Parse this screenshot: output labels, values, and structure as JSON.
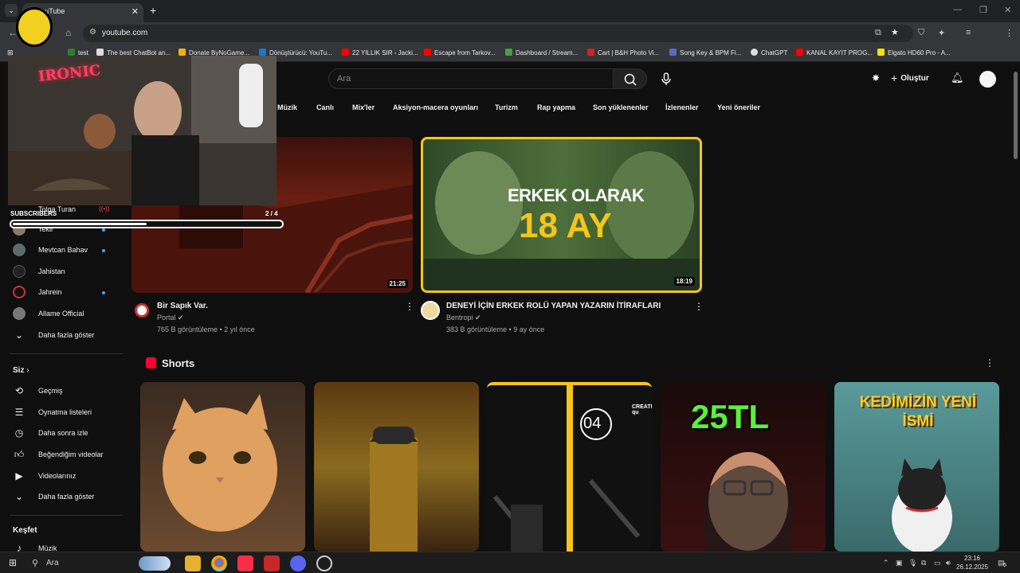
{
  "browser": {
    "tab_title": "YouTube",
    "url": "youtube.com",
    "bookmarks": [
      {
        "label": "test",
        "color": "#2e7d32"
      },
      {
        "label": "The best ChatBot an...",
        "color": "#dddddd"
      },
      {
        "label": "Donate ByNoGame...",
        "color": "#f5b400"
      },
      {
        "label": "Dönüştürücü: YouTu...",
        "color": "#e53935"
      },
      {
        "label": "22 YILLIK SIR - Jacki...",
        "color": "#ff0000"
      },
      {
        "label": "Escape from Tarkov...",
        "color": "#ff0000"
      },
      {
        "label": "Dashboard / Stream...",
        "color": "#43a047"
      },
      {
        "label": "Cart | B&H Photo Vi...",
        "color": "#c62828"
      },
      {
        "label": "Song Key & BPM Fi...",
        "color": "#5c6bc0"
      },
      {
        "label": "ChatGPT",
        "color": "#e0e0e0"
      },
      {
        "label": "KANAL KAYIT PROG...",
        "color": "#ff0000"
      },
      {
        "label": "Elgato HD60 Pro - A...",
        "color": "#f9e300"
      }
    ]
  },
  "youtube": {
    "search_placeholder": "Ara",
    "create_label": "Oluştur",
    "chips": [
      "Müzik",
      "Canlı",
      "Mix'ler",
      "Aksiyon-macera oyunları",
      "Turizm",
      "Rap yapma",
      "Son yüklenenler",
      "İzlenenler",
      "Yeni öneriler"
    ],
    "subscriptions": [
      {
        "name": "Tolga Turan",
        "live": true
      },
      {
        "name": "Tekir",
        "dot": true
      },
      {
        "name": "Mevtcan Bahav",
        "dot": true
      },
      {
        "name": "Jahistan",
        "dot": false
      },
      {
        "name": "Jahrein",
        "dot": true
      },
      {
        "name": "Allame Official",
        "dot": false
      }
    ],
    "show_more": "Daha fazla göster",
    "you_section": {
      "title": "Siz",
      "items": [
        "Geçmiş",
        "Oynatma listeleri",
        "Daha sonra izle",
        "Beğendiğim videolar",
        "Videolarınız",
        "Daha fazla göster"
      ]
    },
    "explore_title": "Keşfet",
    "explore_items": [
      "Müzik"
    ],
    "videos": [
      {
        "title": "Bir Sapık Var.",
        "channel": "Portal",
        "meta": "765 B görüntüleme • 2 yıl önce",
        "duration": "21:25"
      },
      {
        "title": "DENEYİ İÇİN ERKEK ROLÜ YAPAN YAZARIN İTİRAFLARI",
        "channel": "Bentropi",
        "meta": "383 B görüntüleme • 9 ay önce",
        "duration": "18:19",
        "thumb_text_1": "ERKEK OLARAK",
        "thumb_text_2": "18 AY"
      }
    ],
    "shorts_title": "Shorts",
    "shorts": [
      {
        "text": ""
      },
      {
        "text": ""
      },
      {
        "text": "04",
        "sub": "CREATE qu"
      },
      {
        "text": "25TL"
      },
      {
        "text": "KEDİMİZİN YENİ İSMİ"
      }
    ]
  },
  "overlay": {
    "logo": "IRONIC",
    "subscribers_label": "SUBSCRIBERS",
    "subscribers_count": "2 / 4",
    "progress": 0.5
  },
  "taskbar": {
    "search_label": "Ara",
    "time": "23:16",
    "date": "26.12.2025",
    "notification_count": "5"
  }
}
